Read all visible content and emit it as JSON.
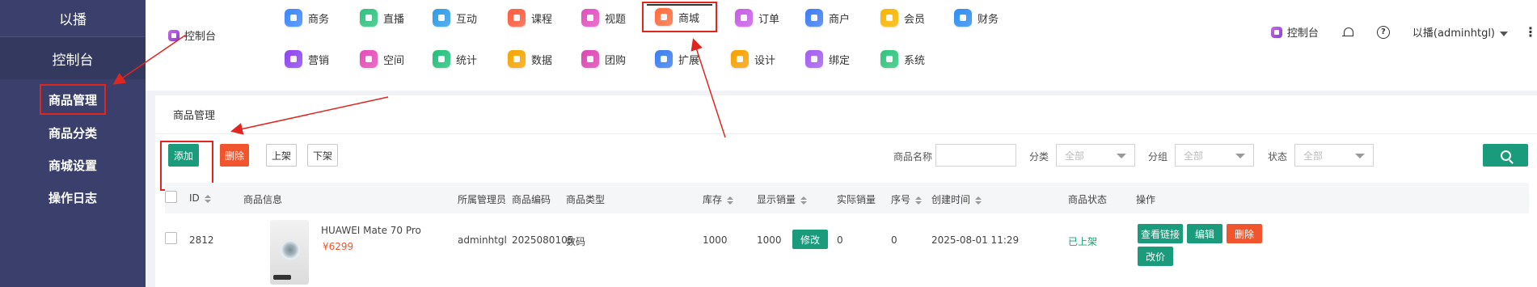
{
  "sidebar": {
    "brand": "以播",
    "console": "控制台",
    "items": [
      {
        "label": "商品管理"
      },
      {
        "label": "商品分类"
      },
      {
        "label": "商城设置"
      },
      {
        "label": "操作日志"
      }
    ]
  },
  "header": {
    "crumb_label": "控制台",
    "modules_row1": [
      {
        "label": "商务",
        "icon": "business-icon",
        "color": "#3a86ff"
      },
      {
        "label": "直播",
        "icon": "live-icon",
        "color": "#2ec27e"
      },
      {
        "label": "互动",
        "icon": "interact-icon",
        "color": "#2f9be8"
      },
      {
        "label": "课程",
        "icon": "course-icon",
        "color": "#ff5a3c"
      },
      {
        "label": "视题",
        "icon": "video-icon",
        "color": "#e24fbf"
      },
      {
        "label": "商城",
        "icon": "mall-icon",
        "color": "#ff6b3d"
      },
      {
        "label": "订单",
        "icon": "order-icon",
        "color": "#c85ce6"
      },
      {
        "label": "商户",
        "icon": "merchant-icon",
        "color": "#3d7cf5"
      },
      {
        "label": "会员",
        "icon": "member-icon",
        "color": "#f7b500"
      },
      {
        "label": "财务",
        "icon": "finance-icon",
        "color": "#2d8cf0"
      }
    ],
    "modules_row2": [
      {
        "label": "营销",
        "icon": "marketing-icon",
        "color": "#8e44ef"
      },
      {
        "label": "空间",
        "icon": "space-icon",
        "color": "#e64bb8"
      },
      {
        "label": "统计",
        "icon": "stats-icon",
        "color": "#22c07a"
      },
      {
        "label": "数据",
        "icon": "data-icon",
        "color": "#f5a500"
      },
      {
        "label": "团购",
        "icon": "groupbuy-icon",
        "color": "#dd45b3"
      },
      {
        "label": "扩展",
        "icon": "extend-icon",
        "color": "#3a7df0"
      },
      {
        "label": "设计",
        "icon": "design-icon",
        "color": "#f7a000"
      },
      {
        "label": "绑定",
        "icon": "bind-icon",
        "color": "#a35cf0"
      },
      {
        "label": "系统",
        "icon": "system-icon",
        "color": "#2fc47c"
      }
    ],
    "right": {
      "console_label": "控制台",
      "user_label": "以播(adminhtgl)",
      "more": "⋮"
    }
  },
  "page": {
    "title": "商品管理",
    "buttons": {
      "add": "添加",
      "delete": "删除",
      "on_shelf": "上架",
      "off_shelf": "下架"
    },
    "filters": {
      "name_label": "商品名称",
      "name_value": "",
      "category_label": "分类",
      "category_value": "全部",
      "group_label": "分组",
      "group_value": "全部",
      "status_label": "状态",
      "status_value": "全部"
    }
  },
  "table": {
    "headers": {
      "id": "ID",
      "info": "商品信息",
      "admin": "所属管理员",
      "code": "商品编码",
      "type": "商品类型",
      "stock": "库存",
      "shown_sales": "显示销量",
      "actual_sales": "实际销量",
      "seq": "序号",
      "created": "创建时间",
      "status": "商品状态",
      "ops": "操作"
    },
    "rows": [
      {
        "id": "2812",
        "name": "HUAWEI Mate 70 Pro",
        "price": "¥6299",
        "admin": "adminhtgl",
        "code": "2025080105",
        "type": "数码",
        "stock": "1000",
        "shown_sales": "1000",
        "edit_sales": "修改",
        "actual_sales": "0",
        "seq": "0",
        "created": "2025-08-01 11:29",
        "status": "已上架",
        "actions": {
          "view_link": "查看链接",
          "edit": "编辑",
          "delete": "删除",
          "change_price": "改价"
        }
      }
    ]
  },
  "colors": {
    "sidebar": "#3a3f6b",
    "accent": "#1a9b7c",
    "danger": "#f0552d",
    "annotation": "#e0261f"
  }
}
